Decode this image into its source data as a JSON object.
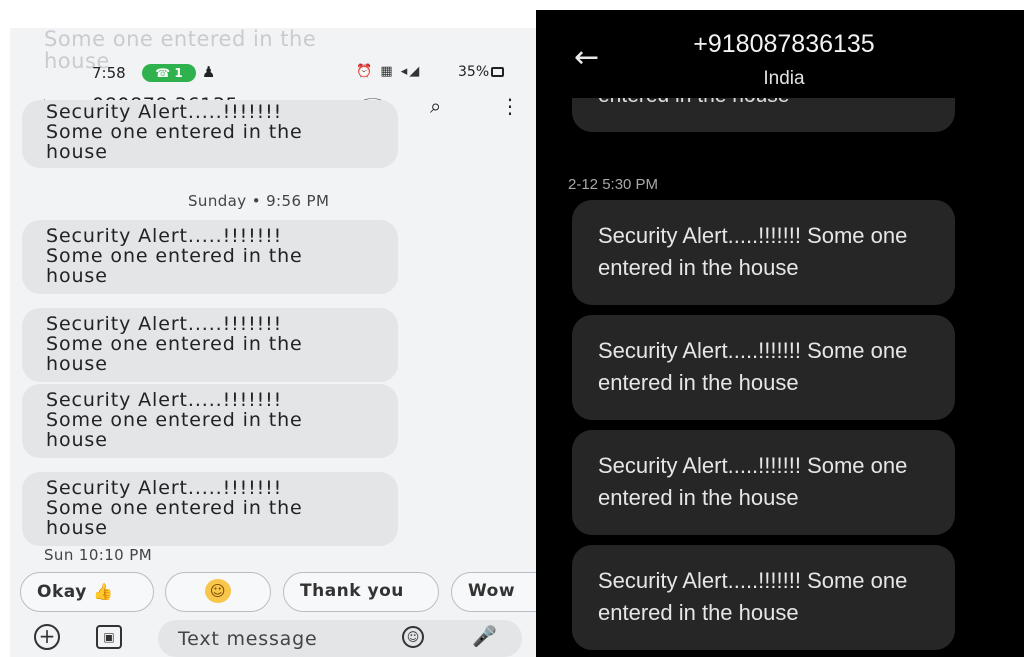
{
  "left_phone": {
    "ghost_lines": [
      "Some one entered in the",
      "house"
    ],
    "status_bar": {
      "time": "7:58",
      "pill": "1",
      "icons_right": "⏰ ▦ ◂◢",
      "battery": "35%"
    },
    "app_bar": {
      "back_icon": "←",
      "contact_number": "080878 36135",
      "video_icon": "▭◂",
      "call_icon": "☏",
      "search_icon": "⌕",
      "more_icon": "⋮"
    },
    "top_partial_message": {
      "lines": [
        "Security Alert.....!!!!!!!",
        "Some one entered in the",
        "house"
      ]
    },
    "timestamp_1": "Sunday • 9:56 PM",
    "messages": [
      {
        "lines": [
          "Security Alert.....!!!!!!!",
          "Some one entered in the",
          "house"
        ]
      },
      {
        "lines": [
          "Security Alert.....!!!!!!!",
          "Some one entered in the",
          "house"
        ]
      },
      {
        "lines": [
          "Security Alert.....!!!!!!!",
          "Some one entered in the",
          "house"
        ]
      },
      {
        "lines": [
          "Security Alert.....!!!!!!!",
          "Some one entered in the",
          "house"
        ]
      }
    ],
    "timestamp_2": "Sun 10:10 PM",
    "smart_replies": [
      {
        "label": "Okay",
        "emoji": "👍"
      },
      {
        "label": "",
        "emoji": "☺"
      },
      {
        "label": "Thank you",
        "emoji": ""
      },
      {
        "label": "Wow",
        "emoji": ""
      }
    ],
    "composer": {
      "add_icon": "+",
      "gallery_icon": "▣",
      "placeholder": "Text message",
      "emoji_icon": "☺",
      "mic_icon": "🎤"
    }
  },
  "right_phone": {
    "back_icon": "←",
    "contact_number": "+918087836135",
    "country": "India",
    "clipped_message": "entered in the house",
    "date": "2-12 5:30 PM",
    "messages": [
      {
        "line1": "Security Alert.....!!!!!!! Some one",
        "line2": "entered in the house"
      },
      {
        "line1": "Security Alert.....!!!!!!! Some one",
        "line2": "entered in the house"
      },
      {
        "line1": "Security Alert.....!!!!!!! Some one",
        "line2": "entered in the house"
      },
      {
        "line1": "Security Alert.....!!!!!!! Some one",
        "line2": "entered in the house"
      }
    ]
  }
}
